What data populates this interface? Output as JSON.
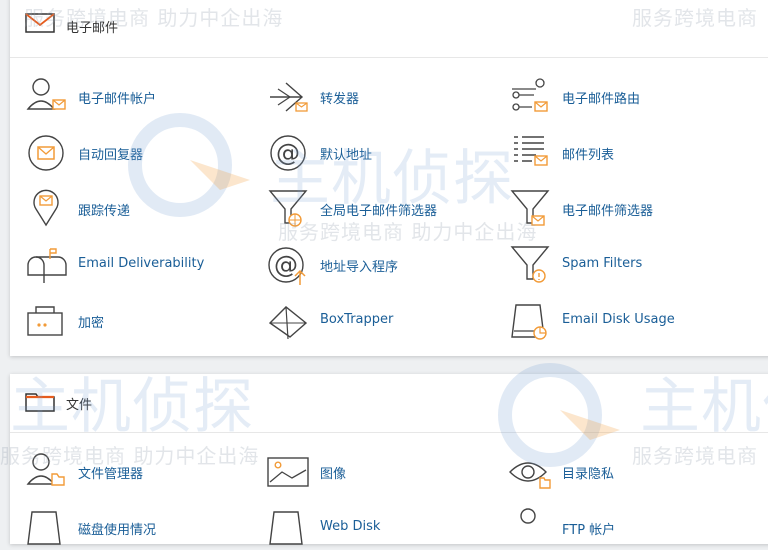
{
  "email_section": {
    "title": "电子邮件",
    "items": [
      {
        "label": "电子邮件帐户",
        "icon": "email-account-icon"
      },
      {
        "label": "转发器",
        "icon": "forwarder-icon"
      },
      {
        "label": "电子邮件路由",
        "icon": "email-routing-icon"
      },
      {
        "label": "自动回复器",
        "icon": "autoresponder-icon"
      },
      {
        "label": "默认地址",
        "icon": "default-address-icon"
      },
      {
        "label": "邮件列表",
        "icon": "mailing-list-icon"
      },
      {
        "label": "跟踪传递",
        "icon": "track-delivery-icon"
      },
      {
        "label": "全局电子邮件筛选器",
        "icon": "global-filter-icon"
      },
      {
        "label": "电子邮件筛选器",
        "icon": "email-filter-icon"
      },
      {
        "label": "Email Deliverability",
        "icon": "mailbox-icon"
      },
      {
        "label": "地址导入程序",
        "icon": "address-importer-icon"
      },
      {
        "label": "Spam Filters",
        "icon": "spam-filter-icon"
      },
      {
        "label": "加密",
        "icon": "encryption-icon"
      },
      {
        "label": "BoxTrapper",
        "icon": "boxtrapper-icon"
      },
      {
        "label": "Email Disk Usage",
        "icon": "email-disk-usage-icon"
      }
    ]
  },
  "files_section": {
    "title": "文件",
    "items": [
      {
        "label": "文件管理器",
        "icon": "file-manager-icon"
      },
      {
        "label": "图像",
        "icon": "images-icon"
      },
      {
        "label": "目录隐私",
        "icon": "directory-privacy-icon"
      },
      {
        "label": "磁盘使用情况",
        "icon": "disk-usage-icon"
      },
      {
        "label": "Web Disk",
        "icon": "web-disk-icon"
      },
      {
        "label": "FTP 帐户",
        "icon": "ftp-account-icon"
      }
    ]
  },
  "watermark": {
    "text": "服务跨境电商 助力中企出海",
    "text_short": "服务跨境电商",
    "logo_text": "主机侦探"
  },
  "colors": {
    "link": "#1a5e97",
    "accent": "#f29b38",
    "icon": "#444444"
  }
}
